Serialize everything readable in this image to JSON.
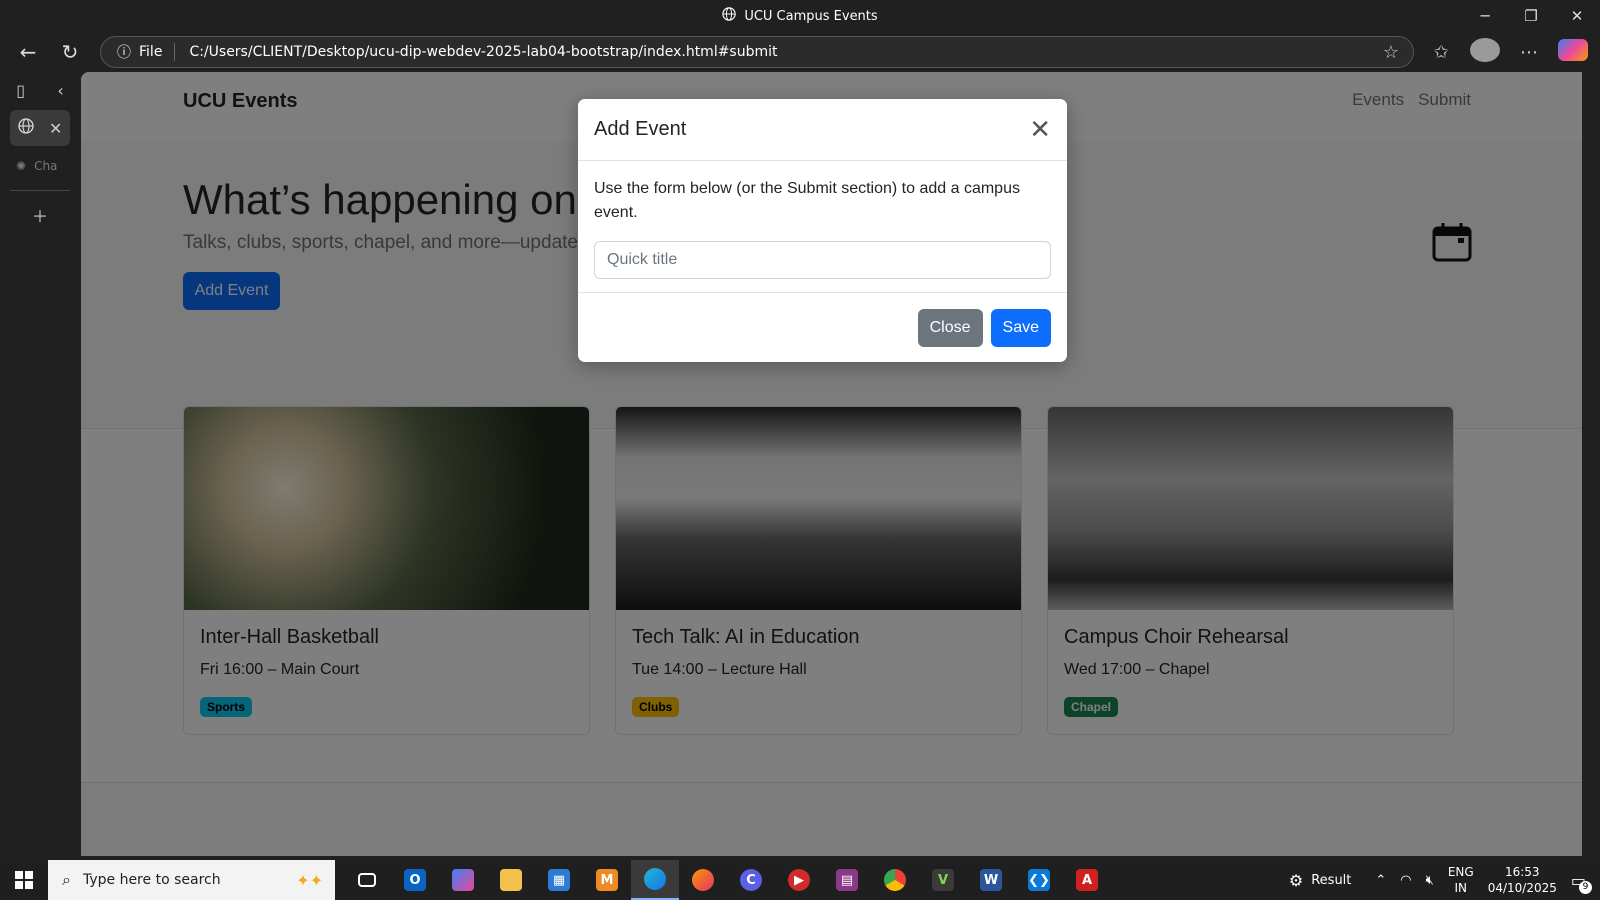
{
  "window": {
    "title": "UCU Campus Events"
  },
  "addressbar": {
    "protocol_label": "File",
    "url": "C:/Users/CLIENT/Desktop/ucu-dip-webdev-2025-lab04-bootstrap/index.html#submit"
  },
  "sidebar": {
    "ghost_tab_label": "Cha"
  },
  "site": {
    "brand": "UCU Events",
    "nav": [
      "Events",
      "Submit"
    ],
    "hero": {
      "title": "What’s happening on campus",
      "subtitle": "Talks, clubs, sports, chapel, and more—updated weekly.",
      "add_button": "Add Event"
    },
    "cards": [
      {
        "title": "Inter-Hall Basketball",
        "when": "Fri 16:00 – Main Court",
        "badge": "Sports",
        "badge_color": "#0dcaf0",
        "image": "person-in-sunlit-field"
      },
      {
        "title": "Tech Talk: AI in Education",
        "when": "Tue 14:00 – Lecture Hall",
        "badge": "Clubs",
        "badge_color": "#ffc107",
        "image": "skyscrapers-looking-up"
      },
      {
        "title": "Campus Choir Rehearsal",
        "when": "Wed 17:00 – Chapel",
        "badge": "Chapel",
        "badge_color": "#198754",
        "image": "lighthouse-bw"
      }
    ]
  },
  "modal": {
    "title": "Add Event",
    "body_text": "Use the form below (or the Submit section) to add a campus event.",
    "input_placeholder": "Quick title",
    "close_button": "Close",
    "save_button": "Save"
  },
  "taskbar": {
    "search_placeholder": "Type here to search",
    "result_label": "Result",
    "lang_line1": "ENG",
    "lang_line2": "IN",
    "time": "16:53",
    "date": "04/10/2025",
    "notifications": "9"
  },
  "colors": {
    "primary": "#0d6efd",
    "secondary": "#6c757d",
    "chrome": "#202020"
  }
}
